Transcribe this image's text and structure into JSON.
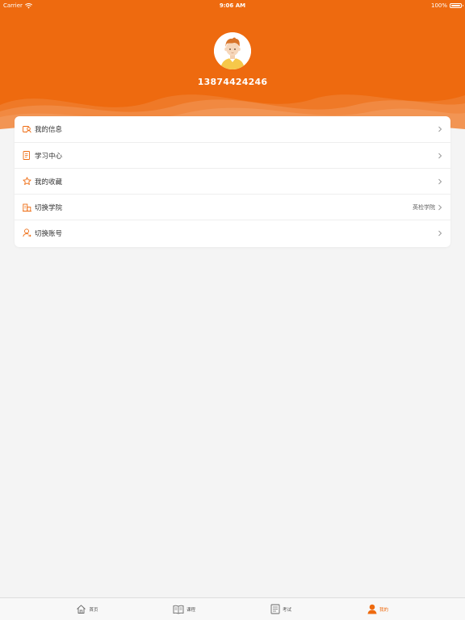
{
  "status_bar": {
    "carrier": "Carrier",
    "time": "9:06 AM",
    "battery": "100%"
  },
  "profile": {
    "phone": "13874424246"
  },
  "menu": [
    {
      "label": "我的信息",
      "icon": "user-card-icon"
    },
    {
      "label": "学习中心",
      "icon": "notebook-icon"
    },
    {
      "label": "我的收藏",
      "icon": "star-icon"
    },
    {
      "label": "切换学院",
      "icon": "building-icon",
      "value": "英检学院"
    },
    {
      "label": "切换账号",
      "icon": "switch-user-icon"
    }
  ],
  "tabs": [
    {
      "label": "首页",
      "icon": "home-icon",
      "active": false
    },
    {
      "label": "课程",
      "icon": "book-icon",
      "active": false
    },
    {
      "label": "考试",
      "icon": "exam-paper-icon",
      "active": false
    },
    {
      "label": "我的",
      "icon": "person-icon",
      "active": true
    }
  ],
  "colors": {
    "accent": "#ee6a0f",
    "background": "#f4f4f4"
  }
}
